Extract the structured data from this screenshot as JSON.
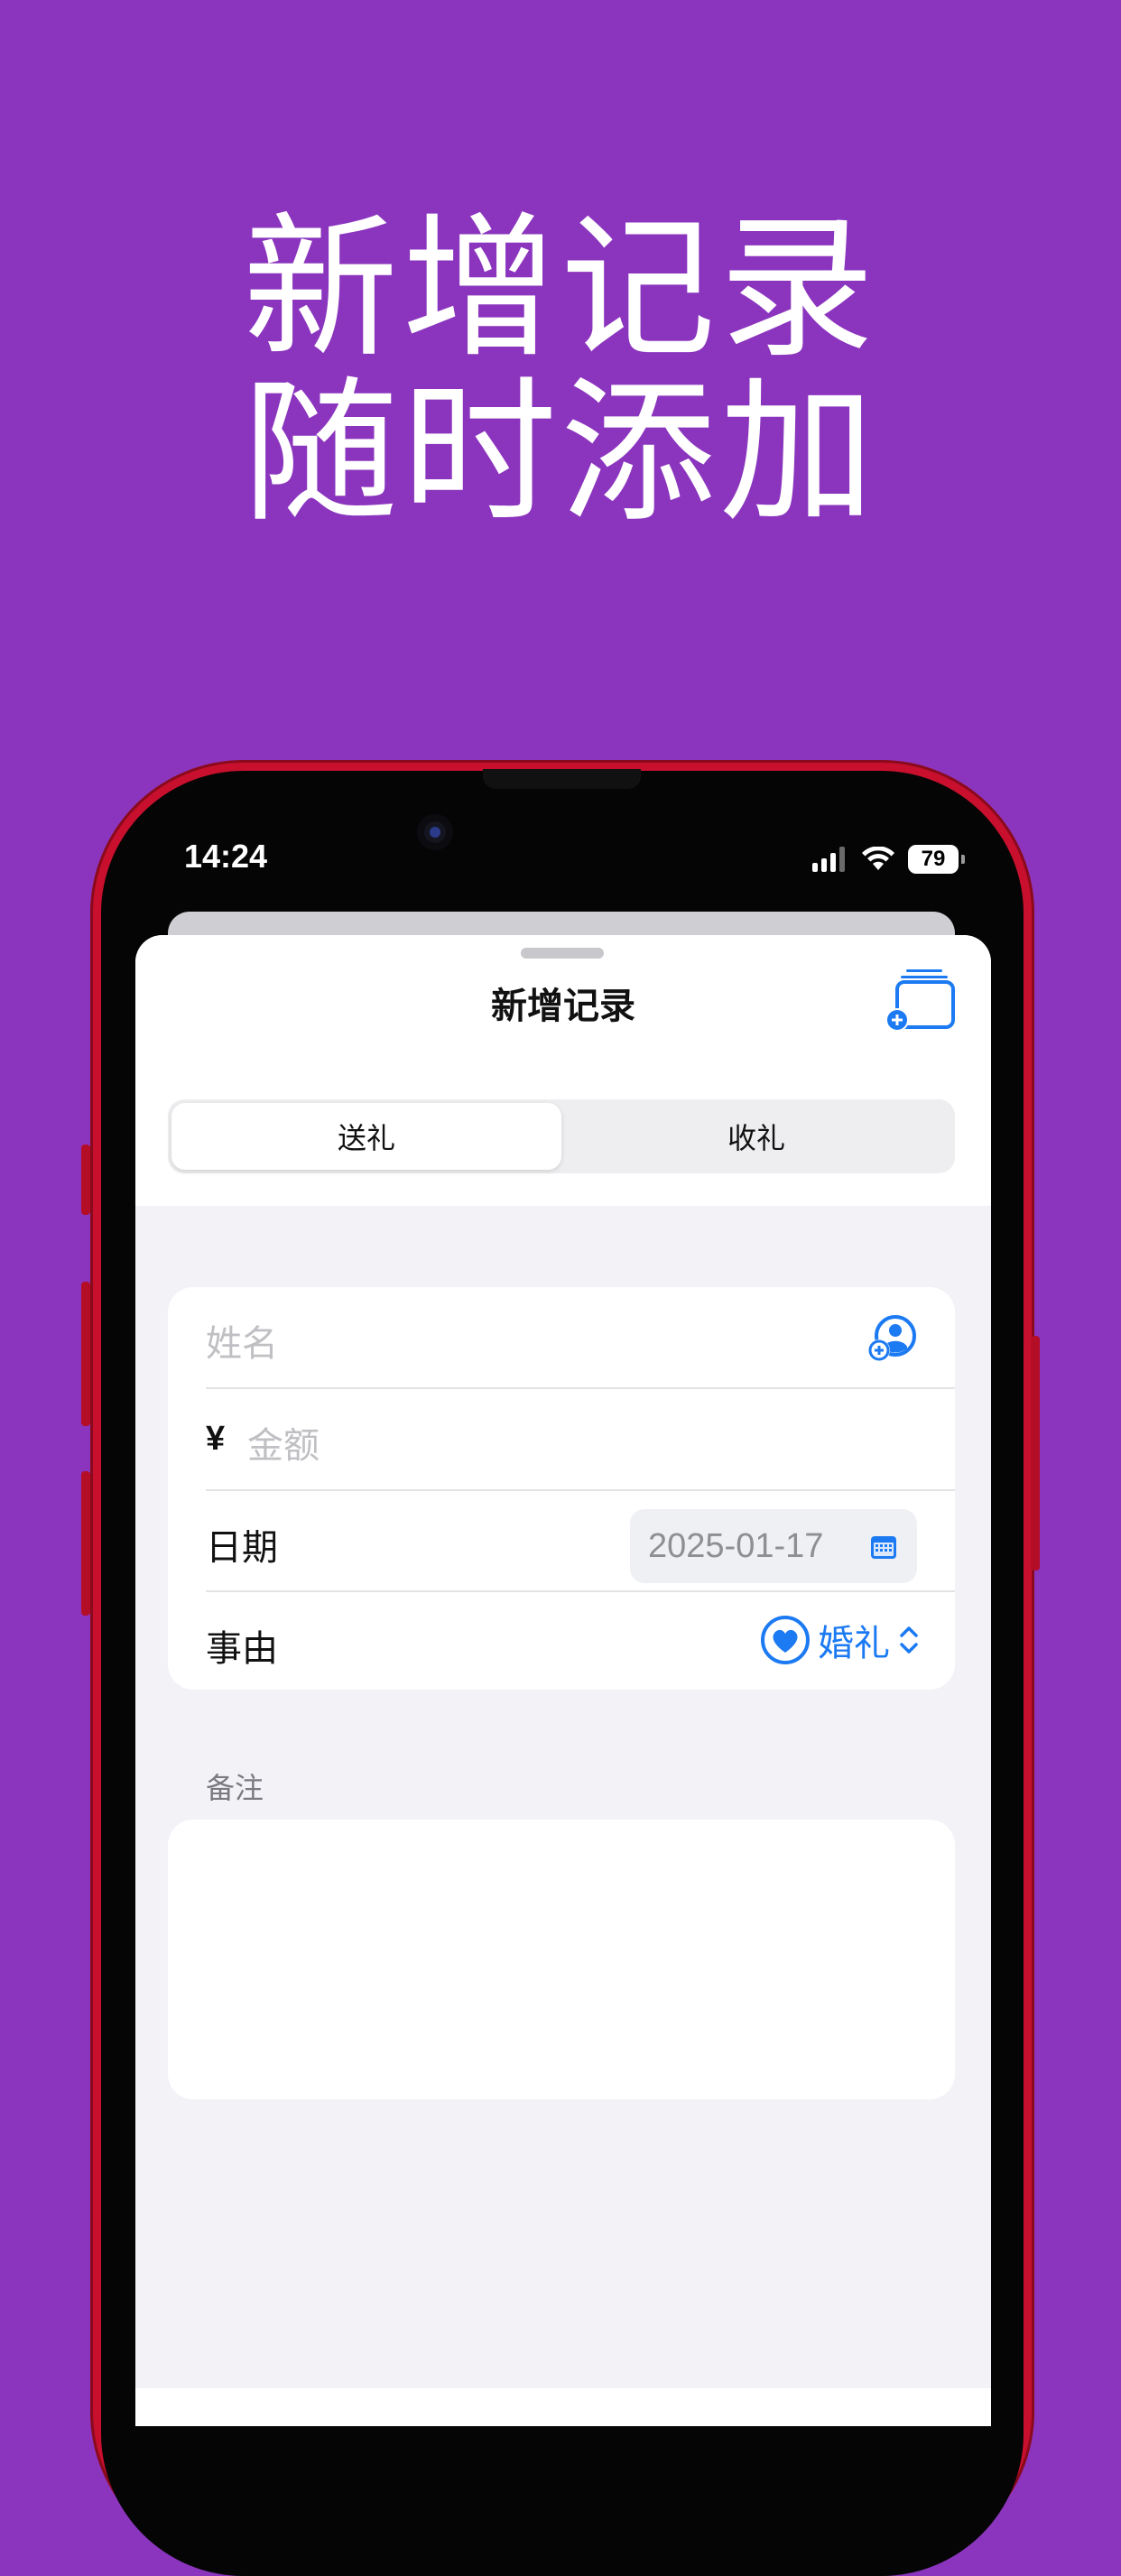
{
  "promo": {
    "line1": "新增记录",
    "line2": "随时添加"
  },
  "status_bar": {
    "time": "14:24",
    "battery": "79"
  },
  "sheet": {
    "title": "新增记录",
    "add_batch_icon": "person-stack-add-icon"
  },
  "segments": {
    "send": "送礼",
    "receive": "收礼",
    "selected": "送礼"
  },
  "form": {
    "name_placeholder": "姓名",
    "contact_icon": "contact-add-icon",
    "currency_symbol": "¥",
    "amount_placeholder": "金额",
    "date_label": "日期",
    "date_value": "2025-01-17",
    "reason_label": "事由",
    "reason_value": "婚礼",
    "reason_icon": "heart-icon"
  },
  "notes": {
    "label": "备注"
  },
  "colors": {
    "background": "#8B35BE",
    "accent": "#1C7AF2",
    "phone_frame": "#C8102E"
  }
}
